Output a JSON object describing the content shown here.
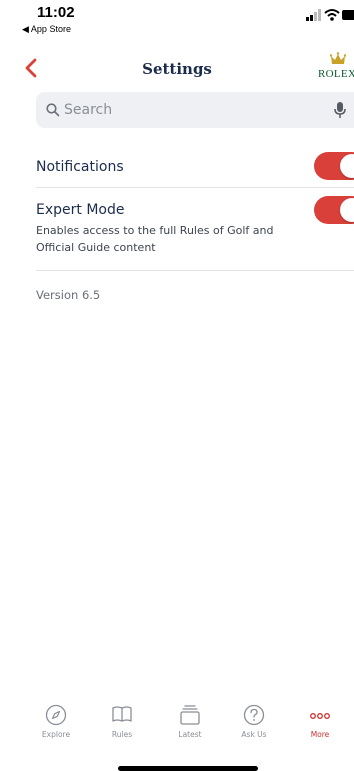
{
  "status_bar": {
    "time": "11:02",
    "back_app": "◀ App Store"
  },
  "nav": {
    "title": "Settings",
    "logo_text": "ROLEX"
  },
  "search": {
    "placeholder": "Search"
  },
  "settings": {
    "notifications": {
      "label": "Notifications",
      "enabled": true
    },
    "expert_mode": {
      "label": "Expert Mode",
      "description": "Enables access to the full Rules of Golf and Official Guide content",
      "enabled": true
    },
    "version": "Version 6.5"
  },
  "tabs": [
    {
      "label": "Explore",
      "icon": "compass-icon",
      "active": false
    },
    {
      "label": "Rules",
      "icon": "book-icon",
      "active": false
    },
    {
      "label": "Latest",
      "icon": "stack-icon",
      "active": false
    },
    {
      "label": "Ask Us",
      "icon": "question-icon",
      "active": false
    },
    {
      "label": "More",
      "icon": "more-dots-icon",
      "active": true
    }
  ],
  "colors": {
    "accent": "#d9403a",
    "active_tab": "#c8322e",
    "title_navy": "#1c2c4c",
    "rolex_green": "#0a5a2e",
    "rolex_gold": "#c9a227"
  }
}
